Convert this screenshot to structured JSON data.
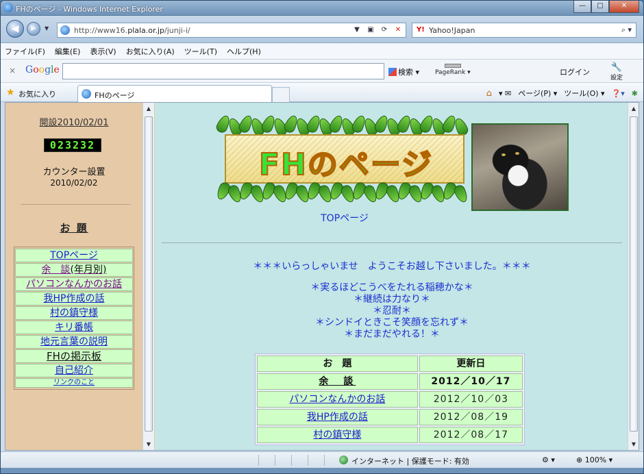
{
  "window": {
    "title": "FHのページ - Windows Internet Explorer",
    "controls": {
      "minimize": "—",
      "maximize": "□",
      "close": "✕"
    }
  },
  "address": {
    "url_prefix": "http://www16.",
    "url_host": "plala.or.jp",
    "url_path": "/junji-i/",
    "search_provider": "Yahoo!Japan"
  },
  "menu": [
    "ファイル(F)",
    "編集(E)",
    "表示(V)",
    "お気に入り(A)",
    "ツール(T)",
    "ヘルプ(H)"
  ],
  "google_bar": {
    "close": "×",
    "logo": [
      "G",
      "o",
      "o",
      "g",
      "l",
      "e"
    ],
    "search_button": "検索",
    "pagerank": "PageRank",
    "login": "ログイン",
    "settings": "設定"
  },
  "favorites": {
    "label": "お気に入り",
    "tab_title": "FHのページ",
    "cmd_page": "ページ(P)",
    "cmd_tools": "ツール(O)"
  },
  "sidebar": {
    "opened": "開設2010/02/01",
    "counter_value": "023232",
    "counter_label": "カウンター設置",
    "counter_date": "2010/02/02",
    "heading": "お 題",
    "items": [
      {
        "label": "TOPページ"
      },
      {
        "label_link": "余　談",
        "label_plain": "(年月別)"
      },
      {
        "label": "パソコンなんかのお話"
      },
      {
        "label": "我HP作成の話"
      },
      {
        "label": "村の鎮守様"
      },
      {
        "label": "キリ番帳"
      },
      {
        "label": "地元言葉の説明"
      },
      {
        "label": "FHの掲示板"
      },
      {
        "label": "自己紹介"
      },
      {
        "label": "リンクのこと"
      }
    ]
  },
  "main": {
    "banner_title": "FHのページ",
    "toppage_label": "TOPページ",
    "welcome": "＊＊＊いらっしゃいませ　ようこそお越し下さいました。＊＊＊",
    "mottos": [
      "＊実るほどこうべをたれる稲穂かな＊",
      "＊継続は力なり＊",
      "＊忍耐＊",
      "＊シンドイときこそ笑顔を忘れず＊",
      "＊まだまだやれる！＊"
    ],
    "table": {
      "headers": [
        "お　題",
        "更新日"
      ],
      "rows": [
        [
          "余　談",
          "2012／10／17"
        ],
        [
          "パソコンなんかのお話",
          "2012／10／03"
        ],
        [
          "我HP作成の話",
          "2012／08／19"
        ],
        [
          "村の鎮守様",
          "2012／08／17"
        ]
      ]
    }
  },
  "status": {
    "zone": "インターネット | 保護モード: 有効",
    "zoom": "100%"
  },
  "colors": {
    "main_bg": "#c4e6e6",
    "sidebar_bg": "#e6c9a7",
    "nav_cell_bg": "#cfffc7",
    "link_blue": "#1b2fd1",
    "banner_text": "#38e23a"
  }
}
